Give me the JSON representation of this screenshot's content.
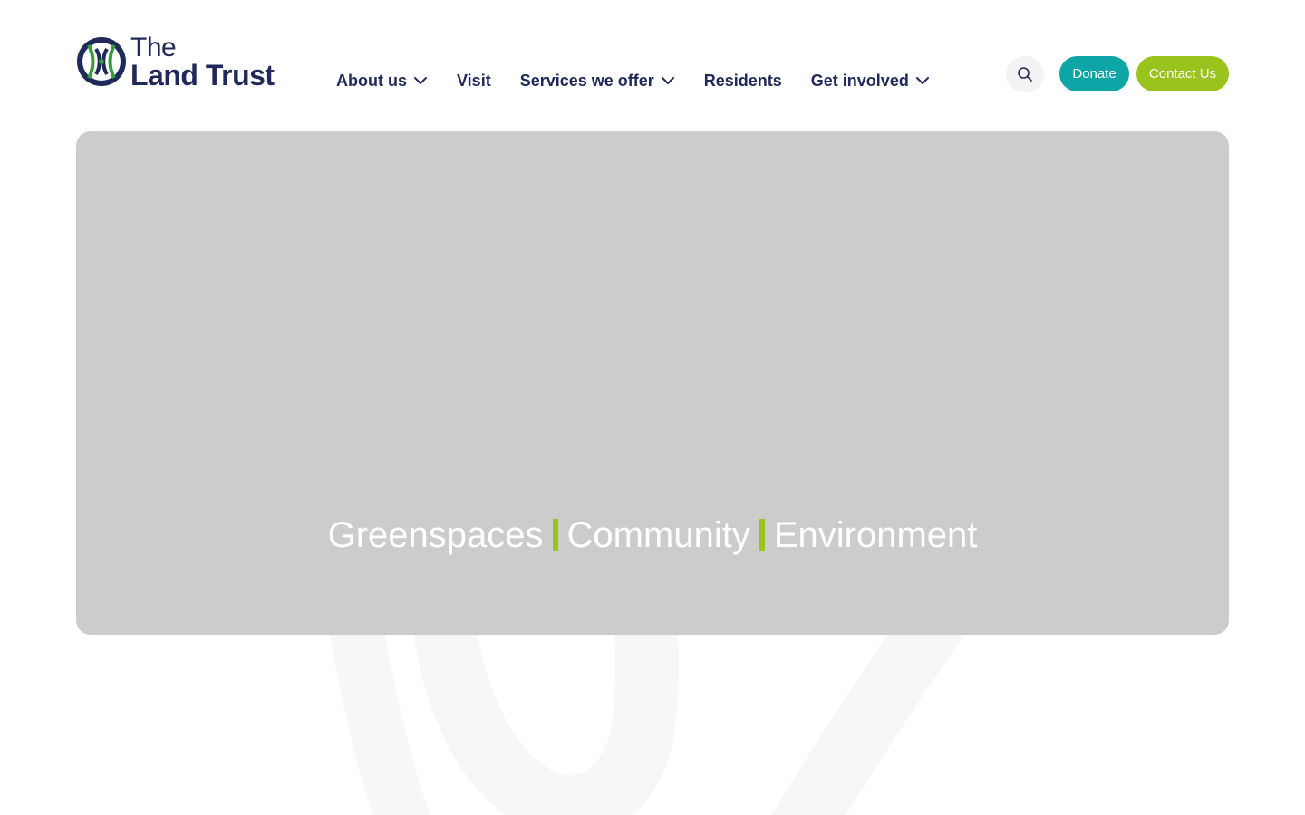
{
  "header": {
    "logo": {
      "the": "The",
      "name": "Land Trust"
    },
    "nav": [
      {
        "label": "About us",
        "has_dropdown": true
      },
      {
        "label": "Visit",
        "has_dropdown": false
      },
      {
        "label": "Services we offer",
        "has_dropdown": true
      },
      {
        "label": "Residents",
        "has_dropdown": false
      },
      {
        "label": "Get involved",
        "has_dropdown": true
      }
    ],
    "search_icon": "search-icon",
    "donate_label": "Donate",
    "contact_label": "Contact Us"
  },
  "hero": {
    "words": [
      "Greenspaces",
      "Community",
      "Environment"
    ]
  },
  "colors": {
    "navy": "#1f2a5a",
    "teal": "#0ea5a6",
    "lime": "#9bc31d",
    "hero_placeholder": "#cccccc"
  }
}
